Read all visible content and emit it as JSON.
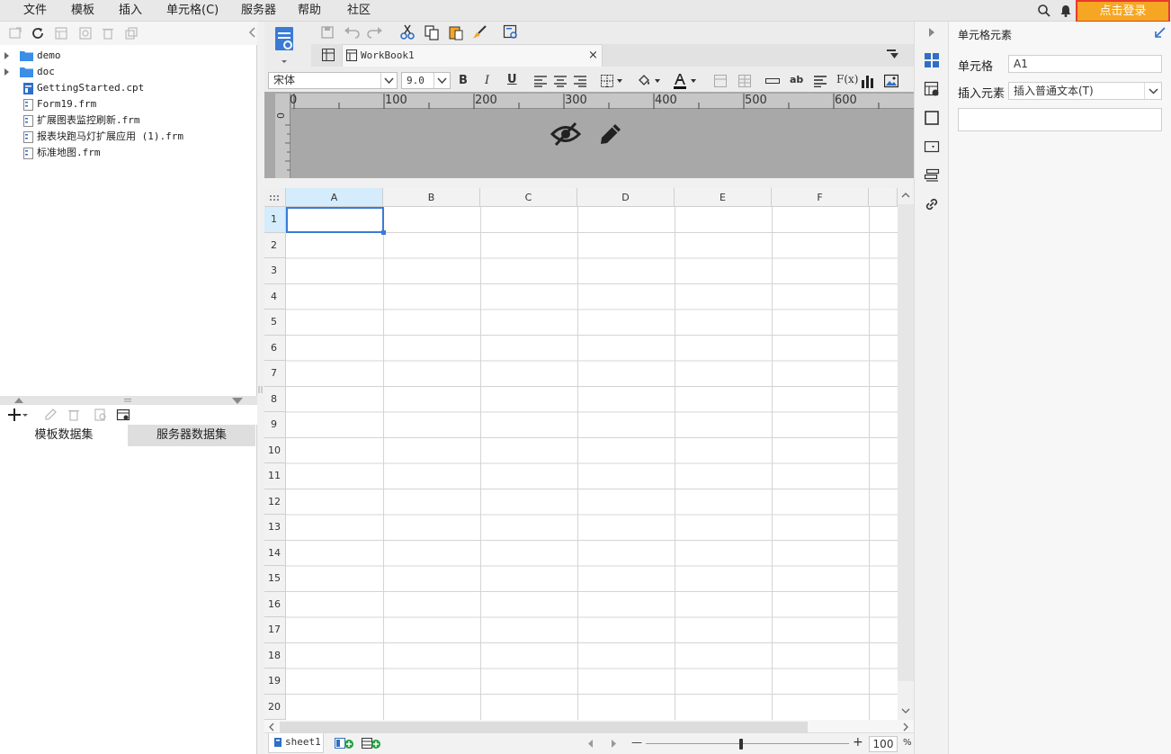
{
  "menubar": {
    "items": [
      {
        "label": "文件"
      },
      {
        "label": "模板"
      },
      {
        "label": "插入"
      },
      {
        "label": "单元格(C)"
      },
      {
        "label": "服务器"
      },
      {
        "label": "帮助"
      },
      {
        "label": "社区"
      }
    ],
    "login_label": "点击登录",
    "icons": [
      "search-icon",
      "bell-icon"
    ]
  },
  "file_tree": {
    "items": [
      {
        "label": "demo",
        "type": "folder"
      },
      {
        "label": "doc",
        "type": "folder"
      },
      {
        "label": "GettingStarted.cpt",
        "type": "report"
      },
      {
        "label": "Form19.frm",
        "type": "form"
      },
      {
        "label": "扩展图表监控刷新.frm",
        "type": "form"
      },
      {
        "label": "报表块跑马灯扩展应用 (1).frm",
        "type": "form"
      },
      {
        "label": "标准地图.frm",
        "type": "form"
      }
    ]
  },
  "dataset": {
    "tabs": [
      {
        "label": "模板数据集"
      },
      {
        "label": "服务器数据集"
      }
    ],
    "active_tab": 1
  },
  "editor": {
    "tab_label": "WorkBook1",
    "close_glyph": "×",
    "font_name": "宋体",
    "font_size": "9.0",
    "ruler_ticks": [
      "0",
      "100",
      "200",
      "300",
      "400",
      "500",
      "600"
    ],
    "vruler_tick": "0",
    "bold": "B",
    "italic": "I",
    "underline": "U",
    "ab": "ab",
    "fx": "F(x)"
  },
  "sheet": {
    "columns": [
      "A",
      "B",
      "C",
      "D",
      "E",
      "F"
    ],
    "rows": [
      "1",
      "2",
      "3",
      "4",
      "5",
      "6",
      "7",
      "8",
      "9",
      "10",
      "11",
      "12",
      "13",
      "14",
      "15",
      "16",
      "17",
      "18",
      "19",
      "20"
    ],
    "selected_cell": "A1",
    "sheet_tab": "sheet1",
    "zoom": "100",
    "zoom_unit": "%",
    "zoom_minus": "—",
    "zoom_plus": "+"
  },
  "right_panel": {
    "title": "单元格元素",
    "cell_label": "单元格",
    "cell_value": "A1",
    "insert_label": "插入元素",
    "insert_value": "插入普通文本(T)"
  },
  "colors": {
    "accent": "#3a7bd5",
    "login_bg": "#f5a623",
    "login_border": "#e8392f",
    "folder": "#3a8ee6"
  }
}
